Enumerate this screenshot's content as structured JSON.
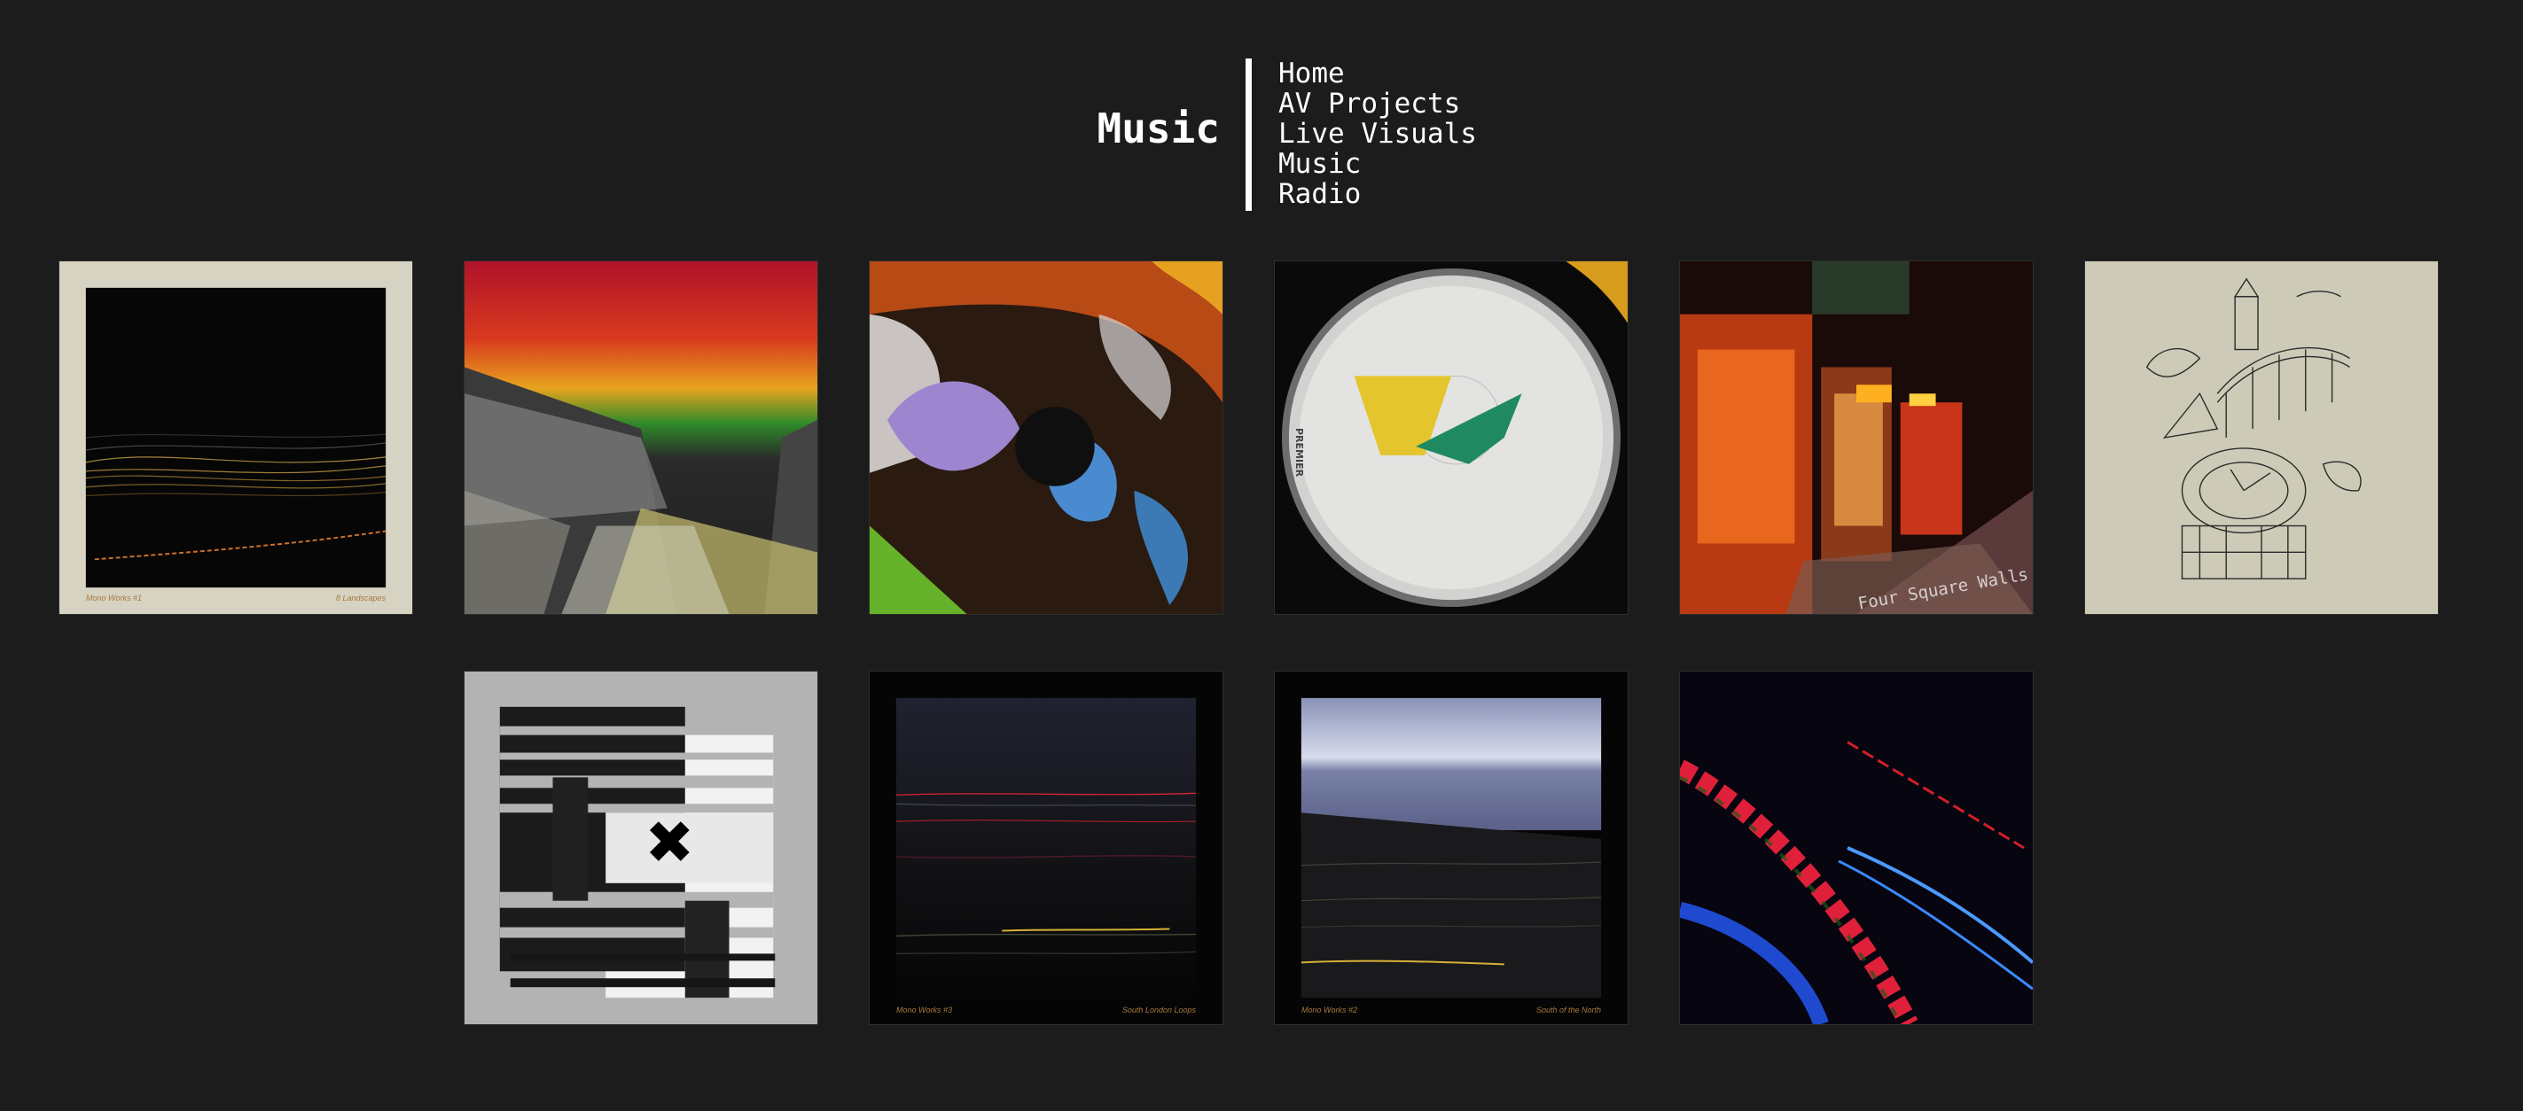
{
  "header": {
    "site_title": "Music",
    "nav": [
      "Home",
      "AV Projects",
      "Live Visuals",
      "Music",
      "Radio"
    ]
  },
  "releases": [
    {
      "cover_left": "Mono Works #1",
      "cover_right": "8 Landscapes"
    },
    {},
    {},
    {
      "drum_brand": "PREMIER"
    },
    {
      "overlay_title": "Four Square Walls"
    },
    {},
    {},
    {
      "cover_left": "Mono Works #3",
      "cover_right": "South London Loops"
    },
    {
      "cover_left": "Mono Works #2",
      "cover_right": "South of the North"
    },
    {}
  ],
  "colors": {
    "background": "#1c1c1c",
    "text": "#ffffff",
    "cover_caption": "#a8783a"
  }
}
